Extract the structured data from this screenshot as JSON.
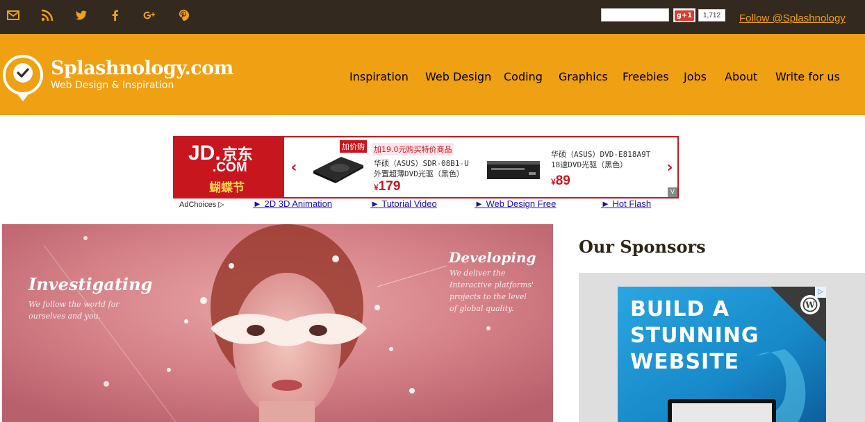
{
  "topbar": {
    "social_icons": [
      "mail-icon",
      "rss-icon",
      "twitter-icon",
      "facebook-icon",
      "google-plus-icon",
      "pinterest-icon"
    ],
    "search_value": "",
    "gplus_label": "g+1",
    "gplus_count": "1,712",
    "follow_label": "Follow @Splashnology"
  },
  "header": {
    "site_name": "Splashnology.com",
    "tagline": "Web Design & Inspiration",
    "nav": [
      "Inspiration",
      "Web Design",
      "Coding",
      "Graphics",
      "Freebies",
      "Jobs",
      "About",
      "Write for us"
    ]
  },
  "ad": {
    "brand": "JD.",
    "brand_cn": "京东",
    "brand_com": ".COM",
    "festival": "蝴蝶节",
    "promo_tag": "加价购",
    "promo_text": "加19.0元购买特价商品",
    "products": [
      {
        "name_line1": "华硕（ASUS）SDR-08B1-U",
        "name_line2": "外置超薄DVD光驱（黑色）",
        "currency": "¥",
        "price": "179"
      },
      {
        "name_line1": "华硕（ASUS）DVD-E818A9T",
        "name_line2": "18速DVD光驱（黑色）",
        "currency": "¥",
        "price": "89"
      }
    ],
    "prev_arrow": "‹",
    "next_arrow": "›",
    "corner_label": "V"
  },
  "ad_links": {
    "adchoices": "AdChoices ▷",
    "links": [
      "► 2D 3D Animation",
      "► Tutorial Video",
      "► Web Design Free",
      "► Hot Flash"
    ]
  },
  "hero": {
    "left_title": "Investigating",
    "left_sub": "We follow the world for ourselves and you.",
    "right_title": "Developing",
    "right_sub": "We deliver the Interactive platforms' projects to the level of global quality."
  },
  "sidebar": {
    "title": "Our Sponsors",
    "ad_headline_1": "BUILD A",
    "ad_headline_2": "STUNNING",
    "ad_headline_3": "WEBSITE",
    "adchoice_mark": "▷"
  },
  "colors": {
    "topbar_bg": "#33291f",
    "header_bg": "#f0a013",
    "accent": "#f0a01b",
    "jd_red": "#c8161e",
    "link_blue": "#1a0dab"
  }
}
